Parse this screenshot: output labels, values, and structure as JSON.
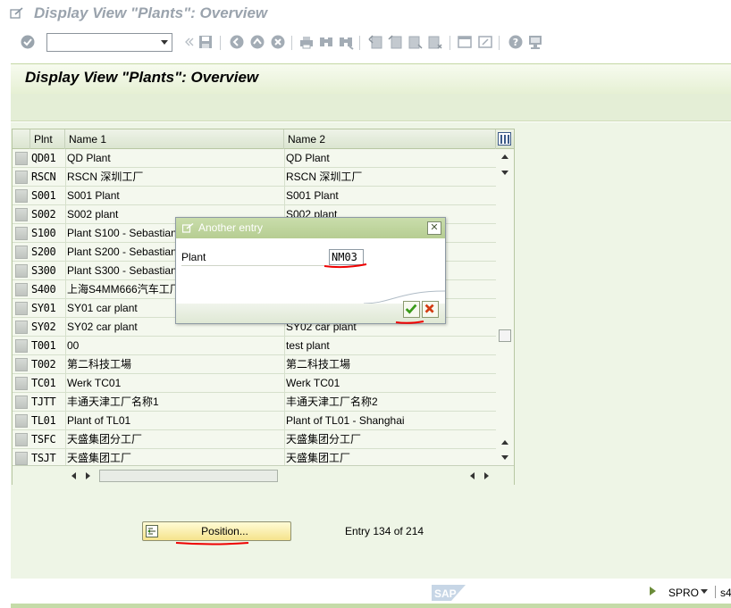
{
  "window": {
    "title": "Display View \"Plants\": Overview"
  },
  "toolbar": {
    "command_field_value": "",
    "icons": [
      "enter-icon",
      "save-icon",
      "back-icon",
      "exit-icon",
      "cancel-icon",
      "print-icon",
      "find-icon",
      "find-next-icon",
      "first-page-icon",
      "previous-page-icon",
      "next-page-icon",
      "last-page-icon",
      "create-session-icon",
      "shortcut-icon",
      "help-icon",
      "customize-layout-icon"
    ]
  },
  "page": {
    "title": "Display View \"Plants\": Overview"
  },
  "table": {
    "columns": [
      "Plnt",
      "Name 1",
      "Name 2"
    ],
    "rows": [
      {
        "plnt": "QD01",
        "name1": "QD Plant",
        "name2": "QD Plant"
      },
      {
        "plnt": "RSCN",
        "name1": "RSCN 深圳工厂",
        "name2": "RSCN 深圳工厂"
      },
      {
        "plnt": "S001",
        "name1": "S001 Plant",
        "name2": "S001 Plant"
      },
      {
        "plnt": "S002",
        "name1": "S002 plant",
        "name2": "S002 plant"
      },
      {
        "plnt": "S100",
        "name1": "Plant S100 - Sebastian",
        "name2": ""
      },
      {
        "plnt": "S200",
        "name1": "Plant S200 - Sebastian",
        "name2": ""
      },
      {
        "plnt": "S300",
        "name1": "Plant S300 - Sebastian",
        "name2": ""
      },
      {
        "plnt": "S400",
        "name1": "上海S4MM666汽车工厂",
        "name2": ""
      },
      {
        "plnt": "SY01",
        "name1": "SY01 car plant",
        "name2": ""
      },
      {
        "plnt": "SY02",
        "name1": "SY02 car plant",
        "name2": "SY02 car plant"
      },
      {
        "plnt": "T001",
        "name1": "00",
        "name2": "test plant"
      },
      {
        "plnt": "T002",
        "name1": "第二科技工場",
        "name2": "第二科技工場"
      },
      {
        "plnt": "TC01",
        "name1": "Werk TC01",
        "name2": "Werk TC01"
      },
      {
        "plnt": "TJTT",
        "name1": "丰通天津工厂名称1",
        "name2": "丰通天津工厂名称2"
      },
      {
        "plnt": "TL01",
        "name1": "Plant of TL01",
        "name2": "Plant of TL01 - Shanghai"
      },
      {
        "plnt": "TSFC",
        "name1": "天盛集团分工厂",
        "name2": "天盛集团分工厂"
      },
      {
        "plnt": "TSJT",
        "name1": "天盛集团工厂",
        "name2": "天盛集团工厂"
      }
    ]
  },
  "dialog": {
    "title": "Another entry",
    "field_label": "Plant",
    "field_value": "NM03"
  },
  "position_button": {
    "label": "Position..."
  },
  "entry_info": "Entry 134 of 214",
  "status_bar": {
    "transaction": "SPRO",
    "system": "s4",
    "logo": "SAP"
  },
  "colors": {
    "panel_green": "#e4eed6",
    "button_yellow": "#f5e38c",
    "annotation_red": "#e00000"
  }
}
